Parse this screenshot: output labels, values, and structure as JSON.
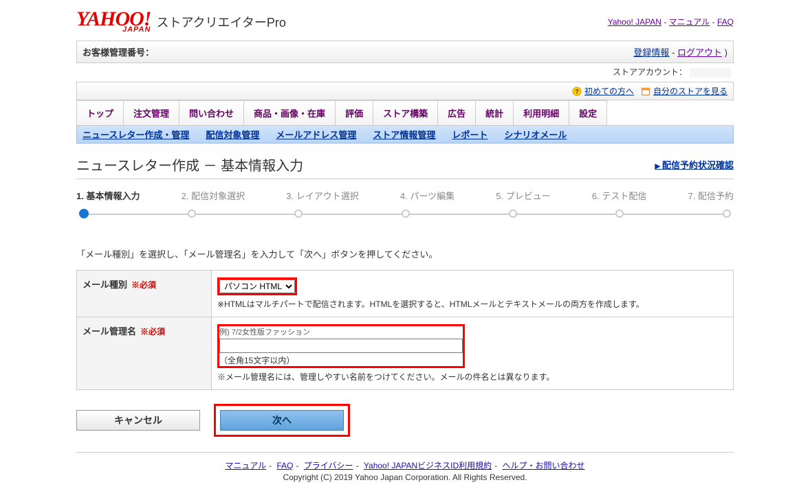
{
  "header": {
    "logo_main": "YAHOO!",
    "logo_sub": "JAPAN",
    "product": "ストアクリエイターPro",
    "links": {
      "yahoo": "Yahoo! JAPAN",
      "manual": "マニュアル",
      "faq": "FAQ"
    }
  },
  "infobar": {
    "label": "お客様管理番号：",
    "reg": "登録情報",
    "logout": "ログアウト"
  },
  "store_account_label": "ストアアカウント：",
  "toolbar": {
    "first": "初めての方へ",
    "view_store": "自分のストアを見る"
  },
  "tabs": [
    "トップ",
    "注文管理",
    "問い合わせ",
    "商品・画像・在庫",
    "評価",
    "ストア構築",
    "広告",
    "統計",
    "利用明細",
    "設定"
  ],
  "subnav": [
    "ニュースレター作成・管理",
    "配信対象管理",
    "メールアドレス管理",
    "ストア情報管理",
    "レポート",
    "シナリオメール"
  ],
  "page_title": "ニュースレター作成 － 基本情報入力",
  "status_link": "配信予約状況確認",
  "steps": [
    "1. 基本情報入力",
    "2. 配信対象選択",
    "3. レイアウト選択",
    "4. パーツ編集",
    "5. プレビュー",
    "6. テスト配信",
    "7. 配信予約"
  ],
  "instruction": "「メール種別」を選択し、「メール管理名」を入力して「次へ」ボタンを押してください。",
  "form": {
    "required": "※必須",
    "row1": {
      "label": "メール種別",
      "select_value": "パソコン HTML",
      "hint": "※HTMLはマルチパートで配信されます。HTMLを選択すると、HTMLメールとテキストメールの両方を作成します。"
    },
    "row2": {
      "label": "メール管理名",
      "example": "例) 7/2女性版ファッション",
      "limit": "（全角15文字以内）",
      "hint": "※メール管理名には、管理しやすい名前をつけてください。メールの件名とは異なります。"
    }
  },
  "buttons": {
    "cancel": "キャンセル",
    "next": "次へ"
  },
  "footer": {
    "links": {
      "manual": "マニュアル",
      "faq": "FAQ",
      "privacy": "プライバシー",
      "terms": "Yahoo! JAPANビジネスID利用規約",
      "help": "ヘルプ・お問い合わせ"
    },
    "copyright": "Copyright (C) 2019 Yahoo Japan Corporation. All Rights Reserved."
  }
}
